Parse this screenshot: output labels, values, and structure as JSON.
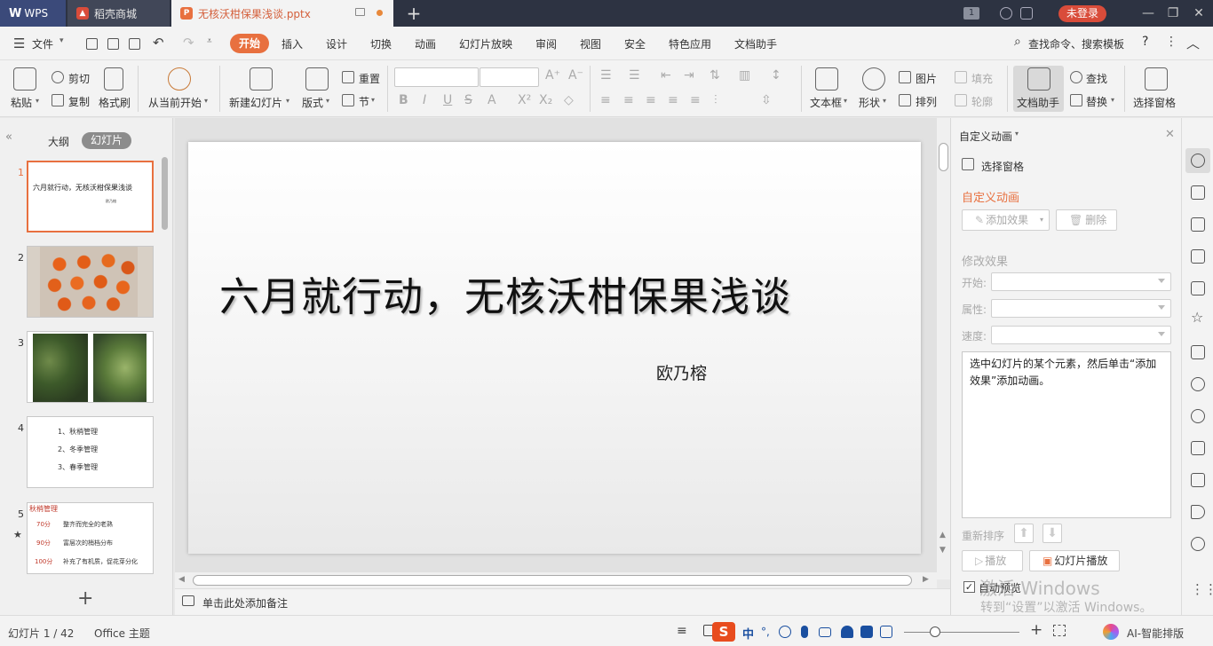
{
  "titlebar": {
    "wps_label": "WPS",
    "store_label": "稻壳商城",
    "doc_label": "无核沃柑保果浅谈.pptx",
    "page_indicator": "1",
    "login_label": "未登录"
  },
  "menu": {
    "file_label": "文件",
    "tabs": [
      "开始",
      "插入",
      "设计",
      "切换",
      "动画",
      "幻灯片放映",
      "审阅",
      "视图",
      "安全",
      "特色应用",
      "文档助手"
    ],
    "search_label": "查找命令、搜索模板",
    "help_label": "?"
  },
  "ribbon": {
    "paste": "粘贴",
    "cut": "剪切",
    "copy": "复制",
    "format_painter": "格式刷",
    "start_from_current": "从当前开始",
    "new_slide": "新建幻灯片",
    "layout": "版式",
    "reset": "重置",
    "section": "节",
    "textbox": "文本框",
    "shape": "形状",
    "picture": "图片",
    "fill": "填充",
    "arrange": "排列",
    "outline": "轮廓",
    "doc_assistant": "文档助手",
    "find": "查找",
    "replace": "替换",
    "select_pane": "选择窗格"
  },
  "leftpanel": {
    "outline_tab": "大纲",
    "slides_tab": "幻灯片",
    "thumbnails": [
      {
        "num": "1",
        "title": "六月就行动，无核沃柑保果浅谈",
        "sub": "欧乃榕"
      },
      {
        "num": "2"
      },
      {
        "num": "3"
      },
      {
        "num": "4",
        "items": [
          "1、秋梢管理",
          "2、冬季管理",
          "3、春季管理"
        ]
      },
      {
        "num": "5",
        "heading": "秋梢管理",
        "rows": [
          {
            "score": "70分",
            "text": "整齐而完全的老熟"
          },
          {
            "score": "90分",
            "text": "富层次的梢档分布"
          },
          {
            "score": "100分",
            "text": "补充了有机质，促花芽分化"
          }
        ]
      }
    ],
    "add_label": "+"
  },
  "slide": {
    "title": "六月就行动，无核沃柑保果浅谈",
    "subtitle": "欧乃榕"
  },
  "notes_placeholder": "单击此处添加备注",
  "rightpane": {
    "header": "自定义动画",
    "select_pane": "选择窗格",
    "section_title": "自定义动画",
    "add_effect": "添加效果",
    "delete": "删除",
    "modify_effect": "修改效果",
    "start_label": "开始:",
    "property_label": "属性:",
    "speed_label": "速度:",
    "info_text": "选中幻灯片的某个元素，然后单击“添加效果”添加动画。",
    "reorder": "重新排序",
    "play": "播放",
    "slideshow": "幻灯片播放",
    "autopreview": "自动预览"
  },
  "statusbar": {
    "slide_counter": "幻灯片 1 / 42",
    "theme": "Office 主题",
    "ai_label": "AI-智能排版",
    "ime_label": "中"
  },
  "watermark": {
    "line1": "激活 Windows",
    "line2": "转到“设置”以激活 Windows。"
  },
  "colors": {
    "accent": "#e8703f",
    "titlebar_bg": "#2d3342",
    "login_bg": "#d94c3a"
  }
}
